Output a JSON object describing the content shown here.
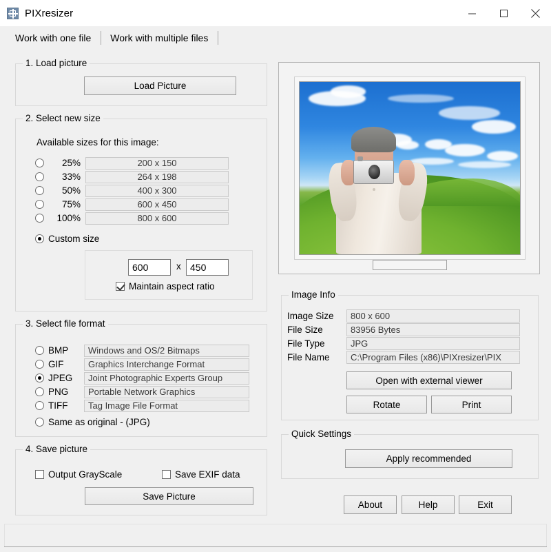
{
  "window": {
    "title": "PIXresizer",
    "icon": "resize-icon",
    "controls": {
      "minimize": "minimize-icon",
      "maximize": "maximize-icon",
      "close": "close-icon"
    }
  },
  "tabs": [
    {
      "label": "Work with one file",
      "active": true
    },
    {
      "label": "Work with multiple files",
      "active": false
    }
  ],
  "load_picture": {
    "legend": "1. Load picture",
    "button": "Load Picture"
  },
  "select_size": {
    "legend": "2. Select new size",
    "available_label": "Available sizes for this image:",
    "options": [
      {
        "percent": "25%",
        "dimensions": "200 x 150",
        "selected": false
      },
      {
        "percent": "33%",
        "dimensions": "264 x 198",
        "selected": false
      },
      {
        "percent": "50%",
        "dimensions": "400 x 300",
        "selected": false
      },
      {
        "percent": "75%",
        "dimensions": "600 x 450",
        "selected": false
      },
      {
        "percent": "100%",
        "dimensions": "800 x 600",
        "selected": false
      }
    ],
    "custom_label": "Custom size",
    "custom_selected": true,
    "width_value": "600",
    "separator": "x",
    "height_value": "450",
    "maintain_aspect_label": "Maintain aspect ratio",
    "maintain_aspect_checked": true
  },
  "file_format": {
    "legend": "3. Select file format",
    "formats": [
      {
        "name": "BMP",
        "description": "Windows and OS/2 Bitmaps",
        "selected": false
      },
      {
        "name": "GIF",
        "description": "Graphics Interchange Format",
        "selected": false
      },
      {
        "name": "JPEG",
        "description": "Joint Photographic Experts Group",
        "selected": true
      },
      {
        "name": "PNG",
        "description": "Portable Network Graphics",
        "selected": false
      },
      {
        "name": "TIFF",
        "description": "Tag Image File Format",
        "selected": false
      }
    ],
    "same_as_original_label": "Same as original  - (JPG)",
    "same_as_original_selected": false
  },
  "save_picture": {
    "legend": "4. Save picture",
    "grayscale_label": "Output GrayScale",
    "grayscale_checked": false,
    "exif_label": "Save EXIF data",
    "exif_checked": false,
    "button": "Save Picture"
  },
  "image_info": {
    "legend": "Image Info",
    "rows": [
      {
        "label": "Image Size",
        "value": "800 x 600"
      },
      {
        "label": "File Size",
        "value": "83956 Bytes"
      },
      {
        "label": "File Type",
        "value": "JPG"
      },
      {
        "label": "File Name",
        "value": "C:\\Program Files (x86)\\PIXresizer\\PIX"
      }
    ],
    "open_viewer_button": "Open with external viewer",
    "rotate_button": "Rotate",
    "print_button": "Print"
  },
  "quick_settings": {
    "legend": "Quick Settings",
    "apply_button": "Apply recommended"
  },
  "footer": {
    "about_button": "About",
    "help_button": "Help",
    "exit_button": "Exit"
  }
}
